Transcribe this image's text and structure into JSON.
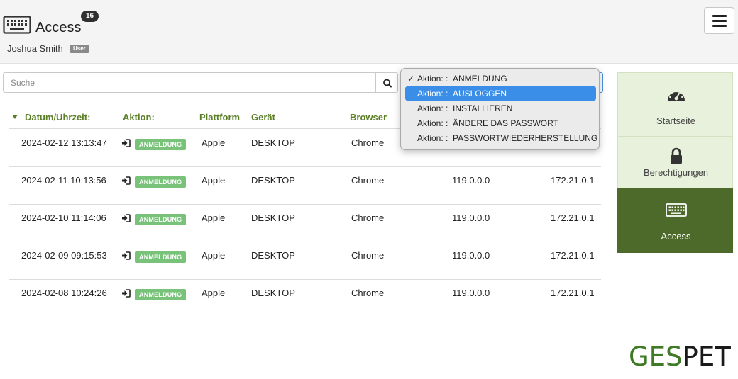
{
  "header": {
    "title": "Access",
    "count": "16",
    "user_name": "Joshua Smith",
    "user_role": "User",
    "menu_icon": "hamburger-menu-icon",
    "page_icon": "keyboard-icon"
  },
  "search": {
    "placeholder": "Suche",
    "button_icon": "search-icon"
  },
  "dropdown": {
    "options": [
      {
        "label": "Aktion: :",
        "value": "ANMELDUNG",
        "checked": true,
        "highlighted": false
      },
      {
        "label": "Aktion: :",
        "value": "AUSLOGGEN",
        "checked": false,
        "highlighted": true
      },
      {
        "label": "Aktion: :",
        "value": "INSTALLIEREN",
        "checked": false,
        "highlighted": false
      },
      {
        "label": "Aktion: :",
        "value": "ÄNDERE DAS PASSWORT",
        "checked": false,
        "highlighted": false
      },
      {
        "label": "Aktion: :",
        "value": "PASSWORTWIEDERHERSTELLUNG",
        "checked": false,
        "highlighted": false
      }
    ],
    "check_mark": "✓"
  },
  "table": {
    "columns": {
      "datetime": "Datum/Uhrzeit:",
      "action": "Aktion:",
      "platform": "Plattform",
      "device": "Gerät",
      "browser": "Browser"
    },
    "rows": [
      {
        "datetime": "2024-02-12 13:13:47",
        "action": "ANMELDUNG",
        "platform": "Apple",
        "device": "DESKTOP",
        "browser": "Chrome",
        "version": "",
        "ip": ""
      },
      {
        "datetime": "2024-02-11 10:13:56",
        "action": "ANMELDUNG",
        "platform": "Apple",
        "device": "DESKTOP",
        "browser": "Chrome",
        "version": "119.0.0.0",
        "ip": "172.21.0.1"
      },
      {
        "datetime": "2024-02-10 11:14:06",
        "action": "ANMELDUNG",
        "platform": "Apple",
        "device": "DESKTOP",
        "browser": "Chrome",
        "version": "119.0.0.0",
        "ip": "172.21.0.1"
      },
      {
        "datetime": "2024-02-09 09:15:53",
        "action": "ANMELDUNG",
        "platform": "Apple",
        "device": "DESKTOP",
        "browser": "Chrome",
        "version": "119.0.0.0",
        "ip": "172.21.0.1"
      },
      {
        "datetime": "2024-02-08 10:24:26",
        "action": "ANMELDUNG",
        "platform": "Apple",
        "device": "DESKTOP",
        "browser": "Chrome",
        "version": "119.0.0.0",
        "ip": "172.21.0.1"
      }
    ]
  },
  "side_nav": {
    "items": [
      {
        "label": "Startseite",
        "icon": "dashboard-gauge-icon",
        "active": false
      },
      {
        "label": "Berechtigungen",
        "icon": "lock-icon",
        "active": false
      },
      {
        "label": "Access",
        "icon": "keyboard-icon",
        "active": true
      }
    ]
  },
  "logo": {
    "part1": "GES",
    "part2": "PET"
  },
  "colors": {
    "accent_green": "#5b7f27",
    "nav_active": "#4d6a2b",
    "nav_bg": "#e7f1dc",
    "badge_green": "#78c27a",
    "selected_blue": "#3b8ee8"
  }
}
